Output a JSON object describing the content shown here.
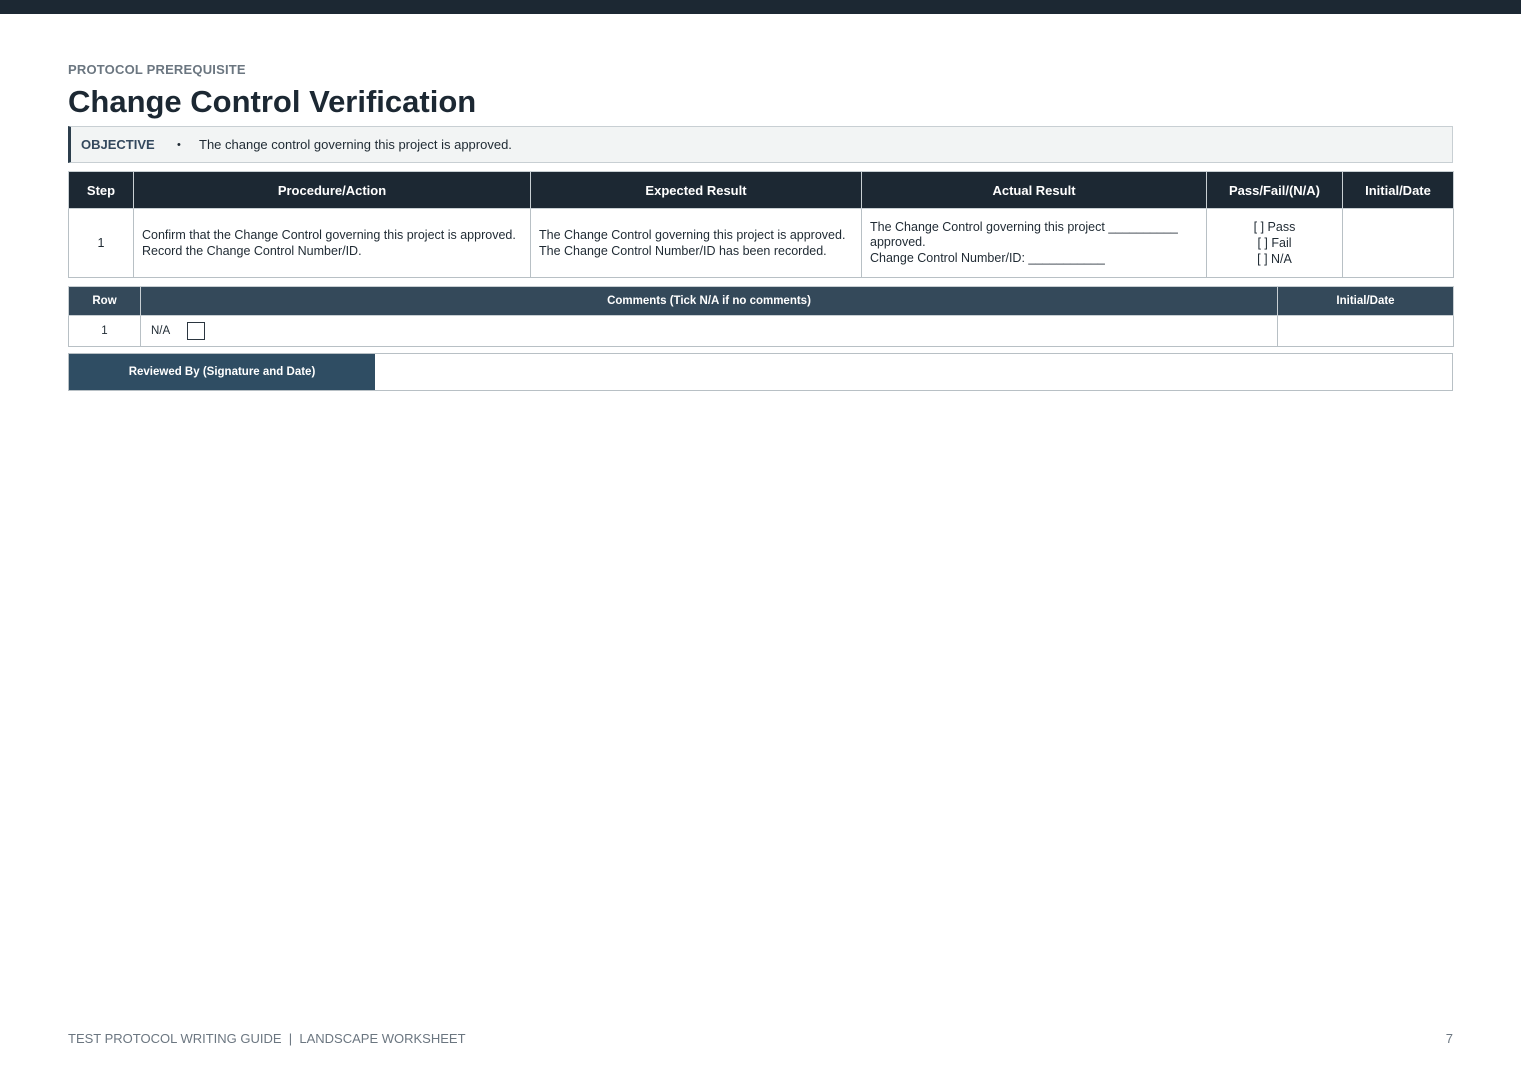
{
  "header": {
    "eyebrow": "PROTOCOL PREREQUISITE",
    "title": "Change Control Verification"
  },
  "objective": {
    "label": "OBJECTIVE",
    "bullet": "•",
    "text": "The change control governing this project is approved."
  },
  "steps_table": {
    "headers": [
      "Step",
      "Procedure/Action",
      "Expected Result",
      "Actual Result",
      "Pass/Fail/(N/A)",
      "Initial/Date"
    ],
    "rows": [
      {
        "step": "1",
        "procedure": [
          "Confirm that the Change Control governing this project is approved.",
          "Record the Change Control Number/ID."
        ],
        "expected": [
          "The Change Control governing this project is approved.",
          "The Change Control Number/ID has been recorded."
        ],
        "actual": [
          "The Change Control governing this project __________",
          "approved.",
          "Change Control Number/ID: ___________"
        ],
        "pass_fail": [
          "[ ] Pass",
          "[ ] Fail",
          "[ ] N/A"
        ],
        "initial_date": ""
      }
    ]
  },
  "comments_table": {
    "headers": [
      "Row",
      "Comments (Tick N/A if no comments)",
      "Initial/Date"
    ],
    "rows": [
      {
        "row": "1",
        "na_label": "N/A",
        "checked": false,
        "initial_date": ""
      }
    ]
  },
  "review": {
    "label": "Reviewed By (Signature and Date)",
    "value": ""
  },
  "footer": {
    "text": "TEST PROTOCOL WRITING GUIDE  |  LANDSCAPE WORKSHEET",
    "page_number": "7"
  }
}
